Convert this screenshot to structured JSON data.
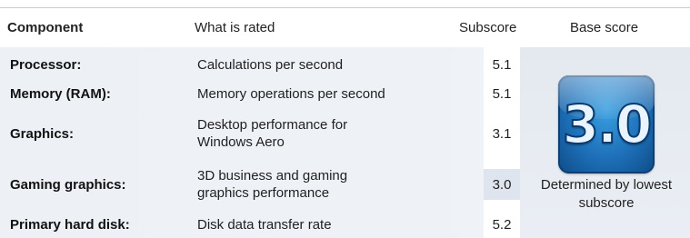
{
  "header": {
    "component": "Component",
    "what_is_rated": "What is rated",
    "subscore": "Subscore",
    "base_score": "Base score"
  },
  "rows": [
    {
      "component": "Processor:",
      "what_is_rated": "Calculations per second",
      "subscore": "5.1",
      "highlighted": false
    },
    {
      "component": "Memory (RAM):",
      "what_is_rated": "Memory operations per second",
      "subscore": "5.1",
      "highlighted": false
    },
    {
      "component": "Graphics:",
      "what_is_rated": "Desktop performance for Windows Aero",
      "subscore": "3.1",
      "highlighted": false
    },
    {
      "component": "Gaming graphics:",
      "what_is_rated": "3D business and gaming graphics performance",
      "subscore": "3.0",
      "highlighted": true
    },
    {
      "component": "Primary hard disk:",
      "what_is_rated": "Disk data transfer rate",
      "subscore": "5.2",
      "highlighted": false
    }
  ],
  "base": {
    "score": "3.0",
    "note": "Determined by lowest subscore",
    "badge_icon": "windows-experience-index-badge",
    "badge_color": "#1d6fb8"
  }
}
